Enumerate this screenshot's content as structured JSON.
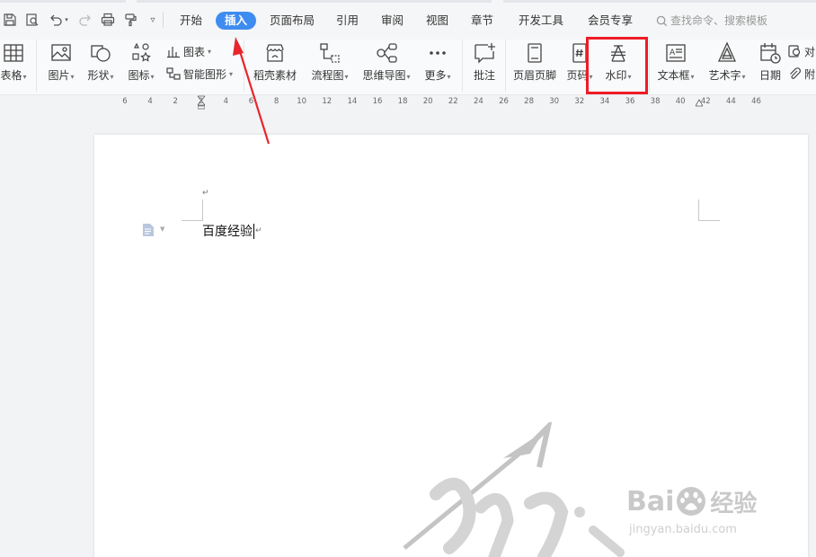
{
  "menu": {
    "tabs": [
      {
        "id": "start",
        "label": "开始"
      },
      {
        "id": "insert",
        "label": "插入",
        "active": true
      },
      {
        "id": "layout",
        "label": "页面布局"
      },
      {
        "id": "reference",
        "label": "引用"
      },
      {
        "id": "review",
        "label": "审阅"
      },
      {
        "id": "view",
        "label": "视图"
      },
      {
        "id": "section",
        "label": "章节"
      },
      {
        "id": "dev",
        "label": "开发工具"
      },
      {
        "id": "member",
        "label": "会员专享"
      }
    ],
    "search_placeholder": "查找命令、搜索模板"
  },
  "ribbon": {
    "table": "表格",
    "picture": "图片",
    "shape": "形状",
    "icon": "图标",
    "chart": "图表",
    "smart_shape": "智能图形",
    "material": "稻壳素材",
    "flowchart": "流程图",
    "mindmap": "思维导图",
    "more": "更多",
    "comment": "批注",
    "header_footer": "页眉页脚",
    "page_number": "页码",
    "watermark": "水印",
    "textbox": "文本框",
    "wordart": "艺术字",
    "date": "日期",
    "object": "对",
    "attachment": "附"
  },
  "ruler": {
    "ticks": [
      "6",
      "4",
      "2",
      "2",
      "4",
      "6",
      "8",
      "10",
      "12",
      "14",
      "16",
      "18",
      "20",
      "22",
      "24",
      "26",
      "28",
      "30",
      "32",
      "34",
      "36",
      "38",
      "40",
      "42",
      "44",
      "46"
    ]
  },
  "document": {
    "body_text": "百度经验",
    "paragraph_mark": "↵"
  },
  "watermark": {
    "brand_left": "Bai",
    "brand_right": "经验",
    "url": "jingyan.baidu.com"
  },
  "colors": {
    "accent": "#3f8cf0",
    "highlight": "#ee1c25",
    "annotation_arrow": "#e8262d"
  }
}
